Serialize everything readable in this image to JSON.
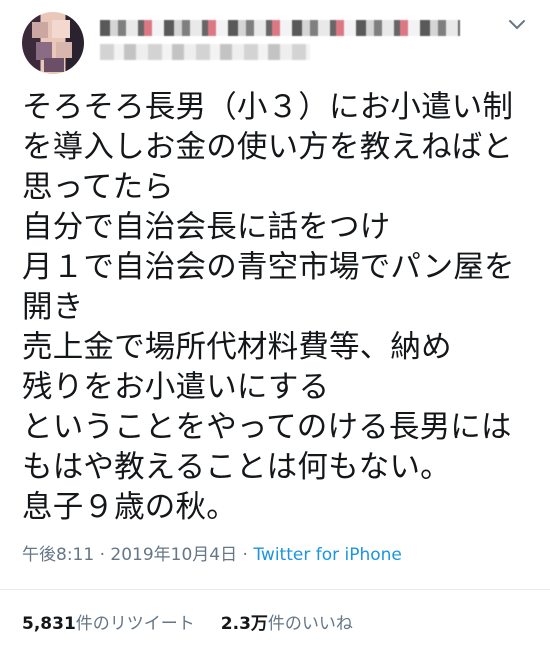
{
  "author": {
    "avatar": "avatar-image"
  },
  "menu": {
    "icon": "chevron-down-icon"
  },
  "tweet": {
    "lines": [
      "そろそろ長男（小３）にお小遣い制",
      "を導入しお金の使い方を教えねばと",
      "思ってたら",
      "自分で自治会長に話をつけ",
      "月１で自治会の青空市場でパン屋を",
      "開き",
      "売上金で場所代材料費等、納め",
      "残りをお小遣いにする",
      "ということをやってのける長男には",
      "もはや教えることは何もない。",
      "息子９歳の秋。"
    ]
  },
  "meta": {
    "time": "午後8:11",
    "separator1": " · ",
    "date": "2019年10月4日",
    "separator2": " · ",
    "source": "Twitter for iPhone"
  },
  "stats": {
    "retweets_count": "5,831",
    "retweets_label": "件のリツイート",
    "likes_count": "2.3万",
    "likes_label": "件のいいね"
  },
  "colors": {
    "text": "#14171a",
    "secondary": "#657786",
    "link": "#1b95e0",
    "divider": "#e6ecf0"
  }
}
